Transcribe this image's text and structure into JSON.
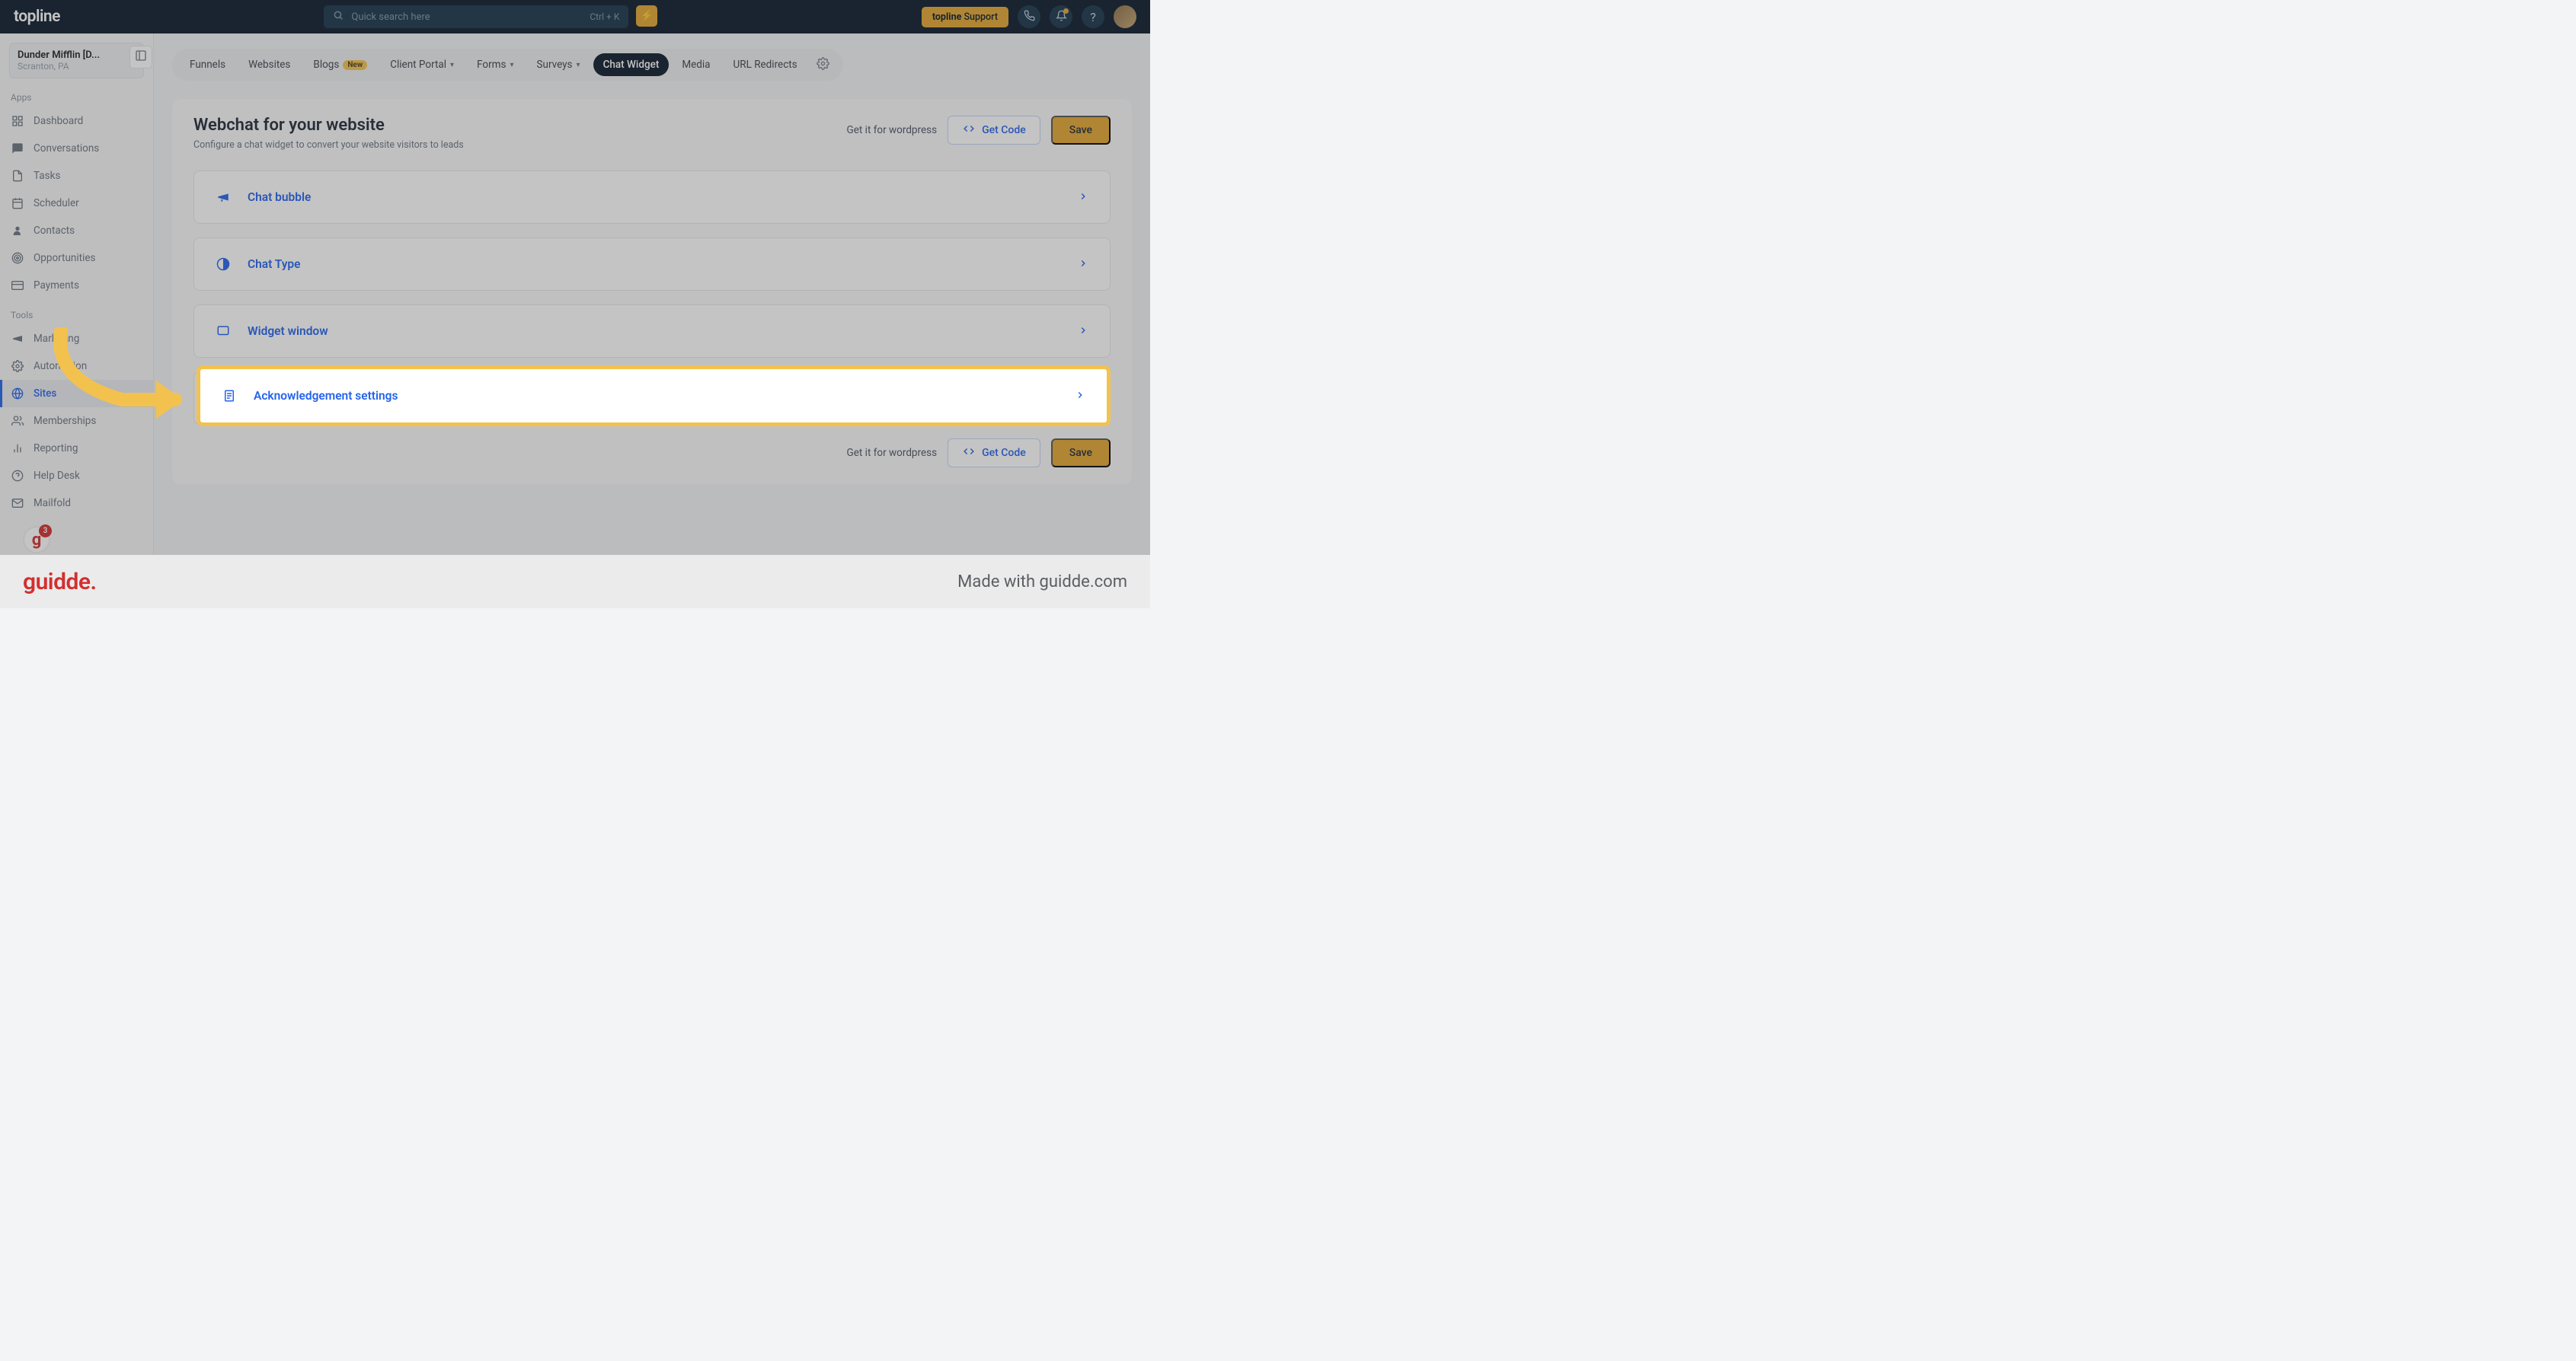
{
  "header": {
    "logo": "topline",
    "search_placeholder": "Quick search here",
    "search_shortcut": "Ctrl + K",
    "support_label_prefix": "topline",
    "support_label_suffix": " Support"
  },
  "account": {
    "name": "Dunder Mifflin [D...",
    "location": "Scranton, PA"
  },
  "sidebar": {
    "sections": {
      "apps_label": "Apps",
      "tools_label": "Tools"
    },
    "apps": [
      {
        "label": "Dashboard"
      },
      {
        "label": "Conversations"
      },
      {
        "label": "Tasks"
      },
      {
        "label": "Scheduler"
      },
      {
        "label": "Contacts"
      },
      {
        "label": "Opportunities"
      },
      {
        "label": "Payments"
      }
    ],
    "tools": [
      {
        "label": "Marketing"
      },
      {
        "label": "Automation"
      },
      {
        "label": "Sites"
      },
      {
        "label": "Memberships"
      },
      {
        "label": "Reporting"
      },
      {
        "label": "Help Desk"
      },
      {
        "label": "Mailfold"
      }
    ],
    "badge_count": "3"
  },
  "tabs": [
    {
      "label": "Funnels"
    },
    {
      "label": "Websites"
    },
    {
      "label": "Blogs",
      "badge": "New"
    },
    {
      "label": "Client Portal",
      "caret": true
    },
    {
      "label": "Forms",
      "caret": true
    },
    {
      "label": "Surveys",
      "caret": true
    },
    {
      "label": "Chat Widget",
      "active": true
    },
    {
      "label": "Media"
    },
    {
      "label": "URL Redirects"
    }
  ],
  "page": {
    "title": "Webchat for your website",
    "subtitle": "Configure a chat widget to convert your website visitors to leads",
    "wordpress_link": "Get it for wordpress",
    "get_code_label": "Get Code",
    "save_label": "Save"
  },
  "accordion": [
    {
      "title": "Chat bubble"
    },
    {
      "title": "Chat Type"
    },
    {
      "title": "Widget window"
    },
    {
      "title": "Acknowledgement settings"
    }
  ],
  "footer": {
    "logo": "guidde.",
    "made_with": "Made with guidde.com"
  }
}
